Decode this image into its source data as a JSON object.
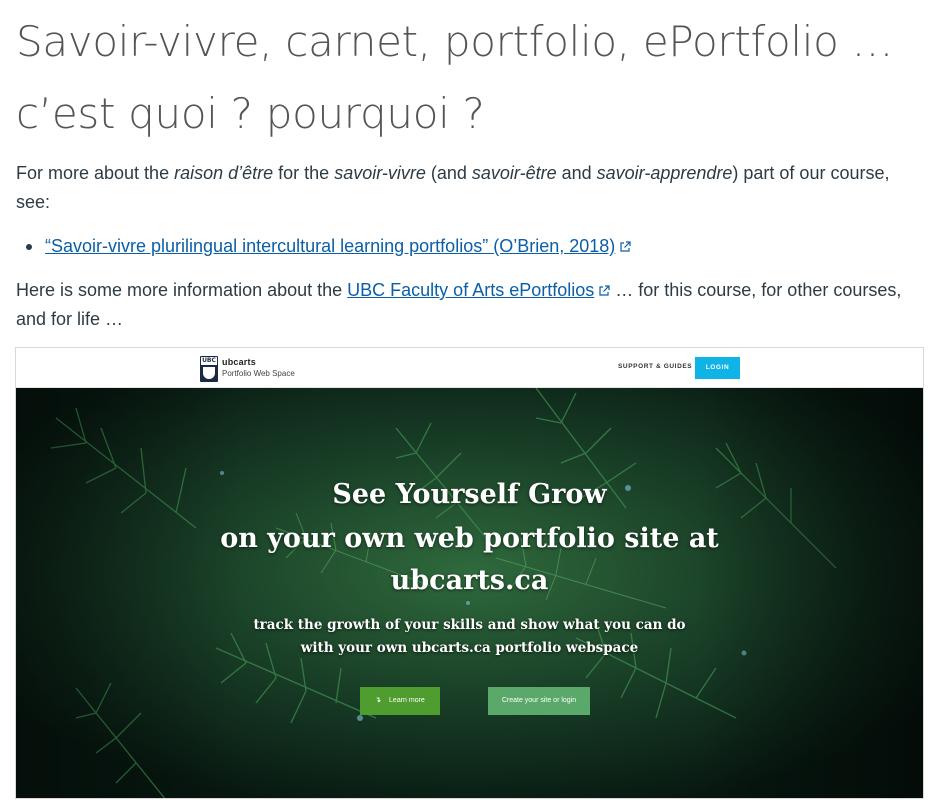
{
  "title": {
    "line1": "Savoir-vivre, carnet, portfolio, ePortfolio …",
    "line2": "c’est quoi ? pourquoi ?"
  },
  "intro": {
    "t1": "For more about the ",
    "e1": "raison d’être",
    "t2": " for the ",
    "e2": "savoir-vivre",
    "t3": " (and ",
    "e3": "savoir-être",
    "t4": " and ",
    "e4": "savoir-apprendre",
    "t5": ") part of our course, see:"
  },
  "links_list": [
    {
      "prefix": "“",
      "label": "Savoir-vivre plurilingual intercultural learning portfolios” (O’Brien, 2018)"
    }
  ],
  "info": {
    "before": "Here is some more information about the ",
    "link": "UBC Faculty of Arts ePortfolios",
    "after": " … for this course, for other courses, and for life …"
  },
  "embed": {
    "logo_text": "UBC",
    "brand_name": "ubcarts",
    "brand_sub": "Portfolio Web Space",
    "nav_support": "SUPPORT & GUIDES",
    "nav_login": "LOGIN",
    "hero_line1": "See Yourself Grow",
    "hero_line2": "on your own web portfolio site at",
    "hero_line3": "ubcarts.ca",
    "hero_sub1": "track the growth of your skills and show what you can do",
    "hero_sub2": "with your own ubcarts.ca portfolio webspace",
    "btn_learn": "Learn more",
    "btn_learn_icon": "↴",
    "btn_create": "Create your site or login"
  },
  "colors": {
    "link": "#0b5ea8",
    "login_button": "#10b3e6",
    "learn_button": "#4f9d2f",
    "create_button": "#5aa96a",
    "hero_bg": "#0c2118"
  },
  "icons": [
    "external-link-icon",
    "ubc-crest-icon",
    "arrow-down-icon"
  ]
}
